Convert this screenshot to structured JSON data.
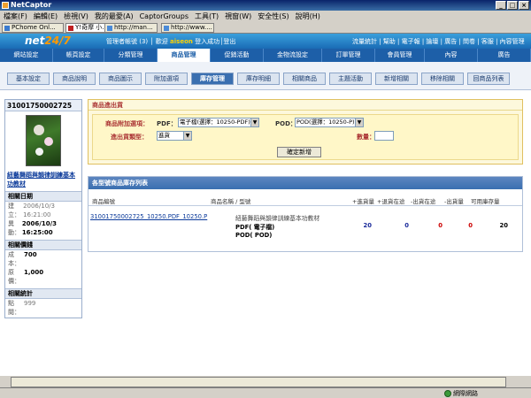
{
  "window": {
    "title": "NetCaptor"
  },
  "menubar": [
    "檔案(F)",
    "編輯(E)",
    "檢視(V)",
    "我的最愛(A)",
    "CaptorGroups",
    "工具(T)",
    "視窗(W)",
    "安全性(S)",
    "說明(H)"
  ],
  "browser_tabs": [
    {
      "label": "PChome Onl..."
    },
    {
      "label": "Y!奇摩 小...",
      "active": true
    },
    {
      "label": "http://man..."
    },
    {
      "label": "http://www...."
    }
  ],
  "site": {
    "logo_main": "net",
    "logo_accent": "24/7",
    "header_links": "管理者帳號 (3) │ 歡迎 ",
    "account": "aiseon",
    "header_links_after": " 登入成功│登出",
    "right_links": "流量統計 | 幫助 | 電子報 | 論壇 | 廣告 | 問卷 | 客服 | 內容管理"
  },
  "main_nav": [
    {
      "label": "網站設定"
    },
    {
      "label": "帳頁設定"
    },
    {
      "label": "分類管理"
    },
    {
      "label": "商品管理",
      "active": true
    },
    {
      "label": "促銷活動"
    },
    {
      "label": "金物流設定"
    },
    {
      "label": "訂單管理"
    },
    {
      "label": "會員管理"
    },
    {
      "label": "內容"
    },
    {
      "label": "廣告"
    }
  ],
  "sub_nav": [
    {
      "label": "基本設定"
    },
    {
      "label": "商品說明"
    },
    {
      "label": "商品圖示"
    },
    {
      "label": "附加選項"
    },
    {
      "label": "庫存管理",
      "active": true
    },
    {
      "label": "庫存明細"
    },
    {
      "label": "相關商品"
    },
    {
      "label": "主題活動"
    },
    {
      "label": "新增相關"
    },
    {
      "label": "移除相關"
    },
    {
      "label": "回商品列表"
    }
  ],
  "left_panel": {
    "product_id": "31001750002725",
    "book_title": "紐藝舞蹈與韻律訓練基本功教材",
    "sections": {
      "dates_title": "相關日期",
      "price_title": "相關價錢",
      "stats_title": "相關統計"
    },
    "dates": [
      {
        "key": "建立：",
        "value": "2006/10/3 16:21:00",
        "bold": false
      },
      {
        "key": "異動：",
        "value": "2006/10/3 16:25:00",
        "bold": true
      }
    ],
    "prices": [
      {
        "key": "成本：",
        "value": "700"
      },
      {
        "key": "原價：",
        "value": "1,000"
      }
    ],
    "stats": [
      {
        "key": "點閱：",
        "value": "999"
      }
    ]
  },
  "stock_form": {
    "title": "商品進出貨",
    "option_label": "商品附加選項：",
    "pdf_label": "PDF：",
    "pdf_value": "電子檔(選擇：10250-PDF)",
    "pod_label": "POD：",
    "pod_value": "POD(選擇：10250-P)",
    "type_label": "進出貨類型：",
    "type_value": "進貨",
    "qty_label": "數量：",
    "qty_value": "",
    "submit_label": "確定新增"
  },
  "stock_list": {
    "title": "各型號商品庫存列表",
    "columns": [
      "商品編號",
      "商品名稱 / 型號",
      "+進貨量",
      "+退貨在途",
      "-出貨在途",
      "-出貨量",
      "可用庫存量"
    ],
    "rows": [
      {
        "code": "31001750002725_10250.PDF_10250.P",
        "name": "紐藝舞蹈與韻律訓練基本功教材",
        "variants": [
          "PDF( 電子檔)",
          "POD( POD)"
        ],
        "in": "20",
        "returning": "0",
        "shipping": "0",
        "out": "0",
        "available": "20"
      }
    ]
  },
  "status": {
    "zone": "網際網路"
  },
  "colors": {
    "nav_blue": "#1d5fa8",
    "link_blue": "#0b3a9a",
    "label_red": "#aa3333"
  }
}
